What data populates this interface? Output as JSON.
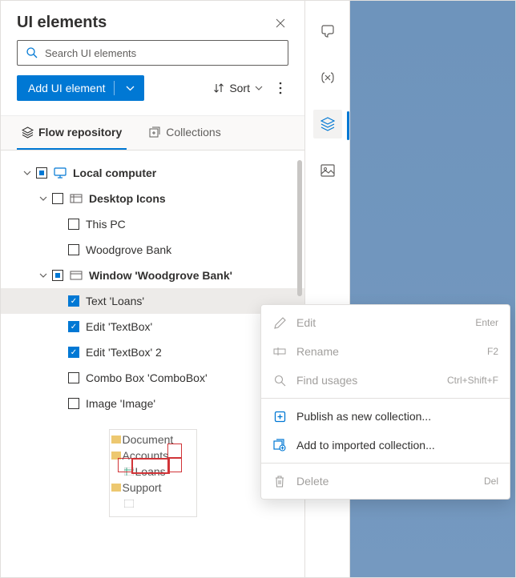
{
  "header": {
    "title": "UI elements"
  },
  "search": {
    "placeholder": "Search UI elements"
  },
  "toolbar": {
    "add_label": "Add UI element",
    "sort_label": "Sort"
  },
  "tabs": {
    "flow": "Flow repository",
    "collections": "Collections"
  },
  "tree": {
    "root": {
      "label": "Local computer"
    },
    "desktop": {
      "label": "Desktop Icons"
    },
    "thispc": {
      "label": "This PC"
    },
    "woodgrove": {
      "label": "Woodgrove Bank"
    },
    "window": {
      "label": "Window 'Woodgrove Bank'"
    },
    "text_loans": {
      "label": "Text 'Loans'"
    },
    "edit_tb": {
      "label": "Edit 'TextBox'"
    },
    "edit_tb2": {
      "label": "Edit 'TextBox' 2"
    },
    "combo": {
      "label": "Combo Box 'ComboBox'"
    },
    "image": {
      "label": "Image 'Image'"
    }
  },
  "preview": {
    "l1": "Document",
    "l2": "Accounts",
    "l3": "Loans",
    "l4": "Support"
  },
  "ctx": {
    "edit": "Edit",
    "edit_k": "Enter",
    "rename": "Rename",
    "rename_k": "F2",
    "find": "Find usages",
    "find_k": "Ctrl+Shift+F",
    "publish": "Publish as new collection...",
    "addto": "Add to imported collection...",
    "delete": "Delete",
    "delete_k": "Del"
  }
}
